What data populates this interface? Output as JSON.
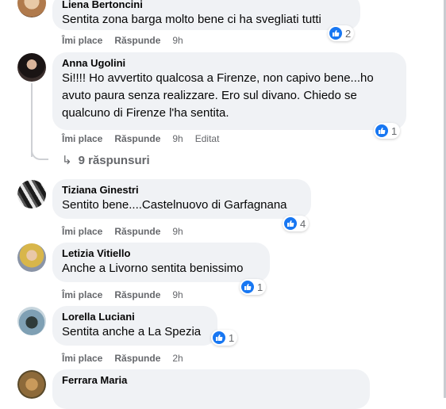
{
  "comments": [
    {
      "author": "Liena Bertoncini",
      "text": "Sentita zona barga molto bene ci ha svegliati tutti",
      "like": "Îmi place",
      "reply": "Răspunde",
      "time": "9h",
      "reaction_count": "2"
    },
    {
      "author": "Anna Ugolini",
      "text": "Si!!!! Ho avvertito qualcosa a Firenze, non capivo bene...ho avuto paura senza realizzare. Ero sul divano. Chiedo se qualcuno di Firenze l'ha sentita.",
      "like": "Îmi place",
      "reply": "Răspunde",
      "time": "9h",
      "edited": "Editat",
      "reaction_count": "1",
      "replies_label": "9 răspunsuri"
    },
    {
      "author": "Tiziana Ginestri",
      "text": "Sentito bene....Castelnuovo di Garfagnana",
      "like": "Îmi place",
      "reply": "Răspunde",
      "time": "9h",
      "reaction_count": "4"
    },
    {
      "author": "Letizia Vitiello",
      "text": "Anche a Livorno sentita benissimo",
      "like": "Îmi place",
      "reply": "Răspunde",
      "time": "9h",
      "reaction_count": "1"
    },
    {
      "author": "Lorella Luciani",
      "text": "Sentita anche a La Spezia",
      "like": "Îmi place",
      "reply": "Răspunde",
      "time": "2h",
      "reaction_count": "1"
    },
    {
      "author": "Ferrara Maria",
      "text": ""
    }
  ],
  "colors": {
    "bubble": "#f0f2f5",
    "secondary_text": "#65676b",
    "like_blue": "#1877f2"
  },
  "icons": [
    "like-thumb-icon",
    "reply-arrow-icon"
  ]
}
